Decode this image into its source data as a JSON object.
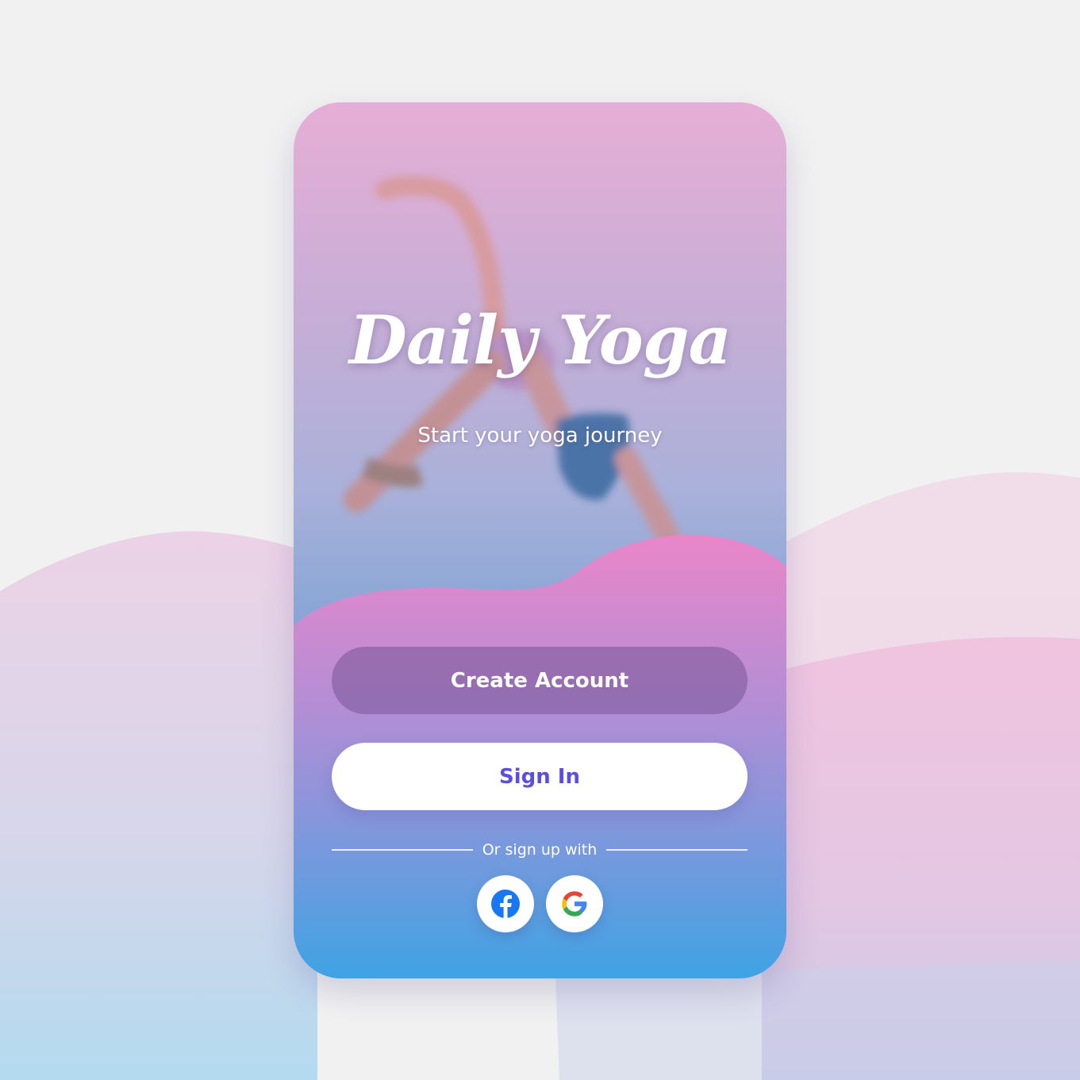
{
  "app": {
    "title": "Daily Yoga",
    "subtitle": "Start your yoga journey"
  },
  "actions": {
    "create_account_label": "Create Account",
    "sign_in_label": "Sign In"
  },
  "social": {
    "divider_label": "Or sign up with",
    "providers": [
      {
        "name": "Facebook",
        "icon": "facebook-icon"
      },
      {
        "name": "Google",
        "icon": "google-icon"
      }
    ]
  },
  "colors": {
    "background": "#f1f1f1",
    "sign_in_text": "#5a4fe0",
    "wave_top": "#ea86c9",
    "wave_bottom": "#3ea3e4",
    "facebook_blue": "#1877f2"
  }
}
